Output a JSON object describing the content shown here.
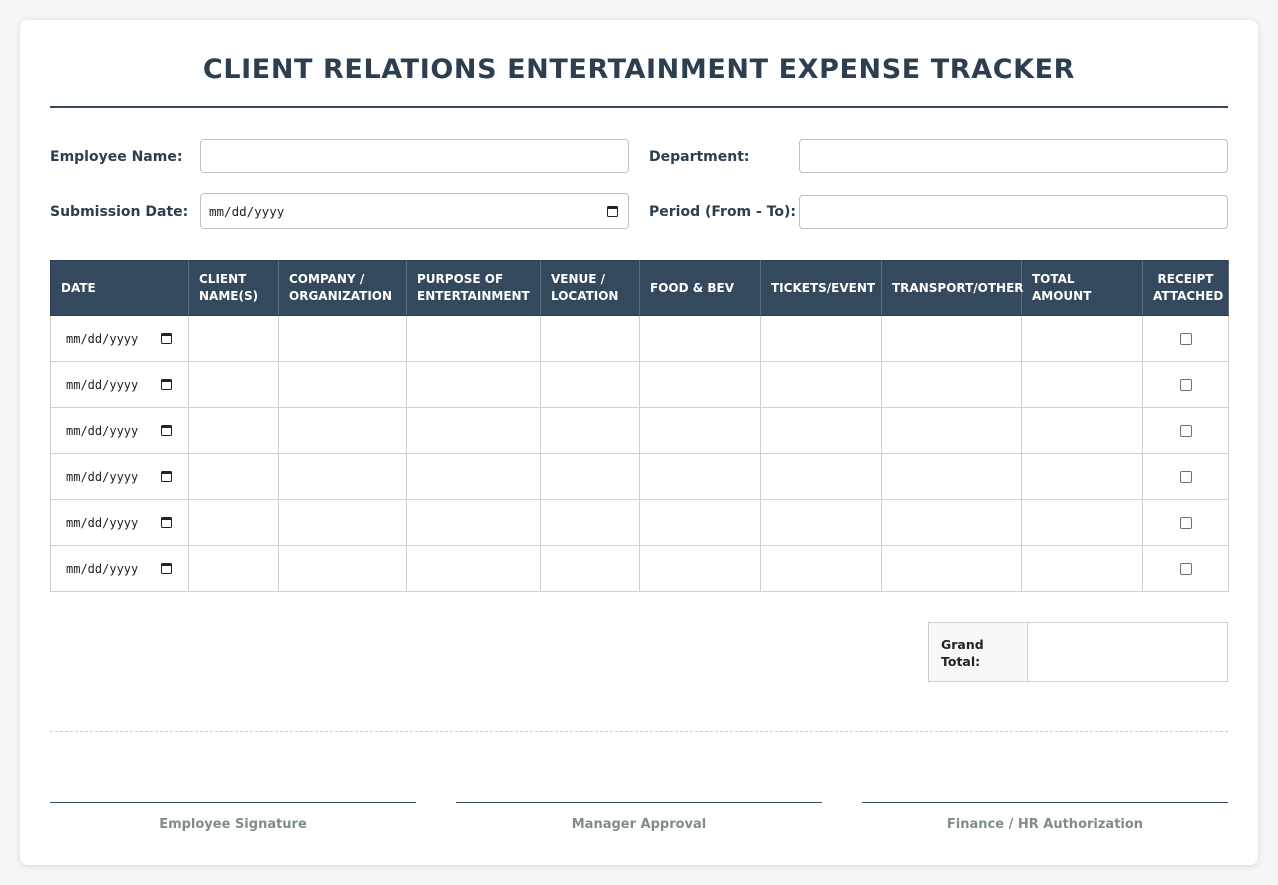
{
  "title": "CLIENT RELATIONS ENTERTAINMENT EXPENSE TRACKER",
  "fields": {
    "employee_name": {
      "label": "Employee Name:",
      "value": ""
    },
    "department": {
      "label": "Department:",
      "value": ""
    },
    "submission_date": {
      "label": "Submission Date:",
      "placeholder": "mm/dd/yyyy"
    },
    "period": {
      "label": "Period (From - To):",
      "value": ""
    }
  },
  "table": {
    "headers": [
      "DATE",
      "CLIENT NAME(S)",
      "COMPANY / ORGANIZATION",
      "PURPOSE OF ENTERTAINMENT",
      "VENUE / LOCATION",
      "FOOD & BEV",
      "TICKETS/EVENT",
      "TRANSPORT/OTHER",
      "TOTAL AMOUNT",
      "RECEIPT ATTACHED"
    ],
    "date_placeholder": "mm/dd/yyyy",
    "rows": [
      {
        "date": "mm/dd/yyyy",
        "receipt": false
      },
      {
        "date": "mm/dd/yyyy",
        "receipt": false
      },
      {
        "date": "mm/dd/yyyy",
        "receipt": false
      },
      {
        "date": "mm/dd/yyyy",
        "receipt": false
      },
      {
        "date": "mm/dd/yyyy",
        "receipt": false
      },
      {
        "date": "mm/dd/yyyy",
        "receipt": false
      }
    ]
  },
  "grand_total": {
    "label": "Grand Total:",
    "value": ""
  },
  "signatures": [
    "Employee Signature",
    "Manager Approval",
    "Finance / HR Authorization"
  ],
  "colors": {
    "header_bg": "#34495e",
    "title_text": "#2c3e50",
    "signature_text": "#7f8c8d"
  }
}
